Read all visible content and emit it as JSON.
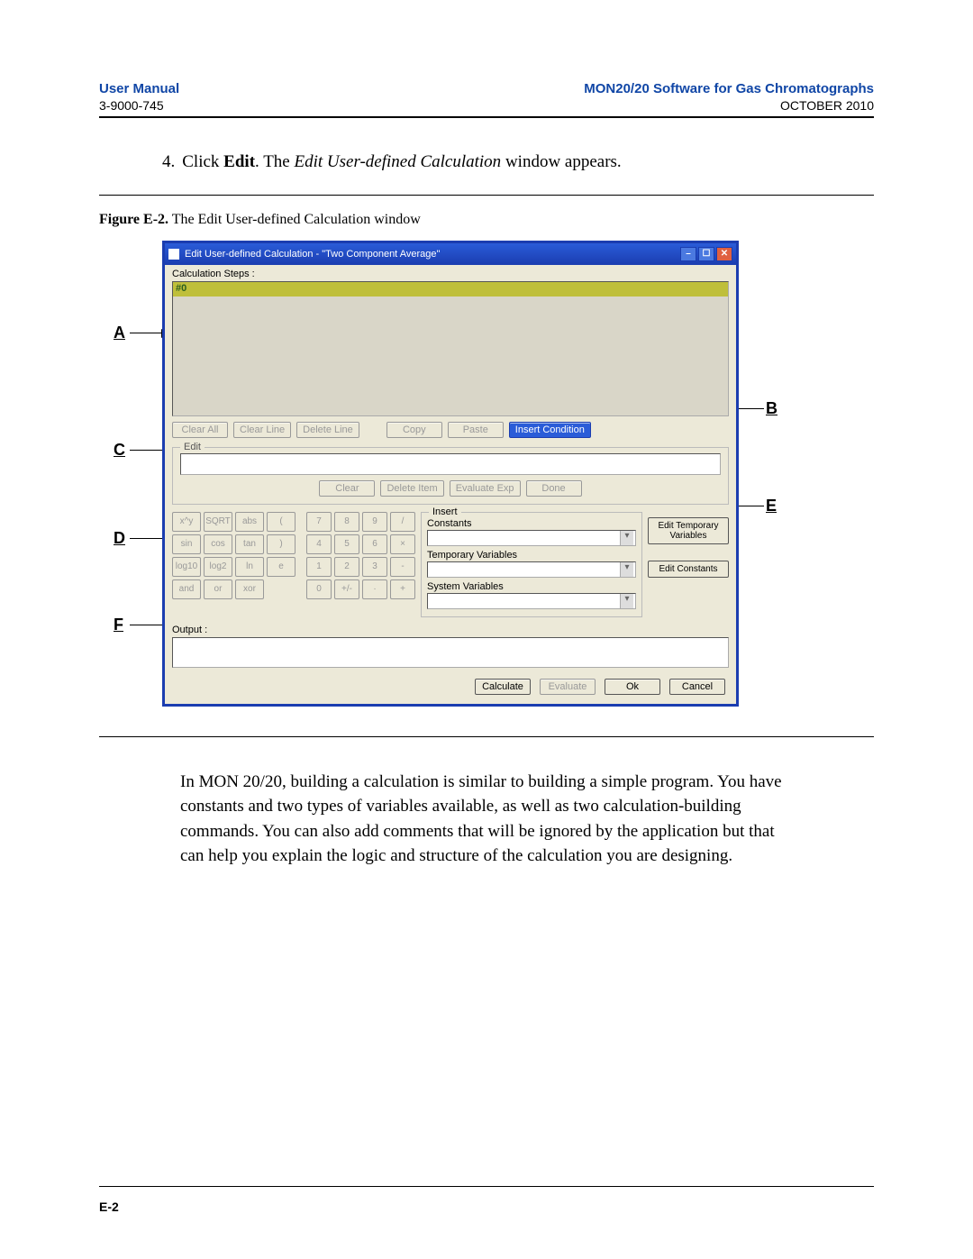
{
  "header": {
    "left_title": "User Manual",
    "left_sub": "3-9000-745",
    "right_title": "MON20/20 Software for Gas Chromatographs",
    "right_sub": "OCTOBER 2010"
  },
  "step": {
    "num": "4.",
    "pre": "Click ",
    "bold": "Edit",
    "mid": ".  The ",
    "ital": "Edit User-defined Calculation",
    "post": " window appears."
  },
  "figure": {
    "num": "Figure E-2.",
    "caption": "The Edit User-defined Calculation window"
  },
  "callouts": {
    "A": "A",
    "B": "B",
    "C": "C",
    "D": "D",
    "E": "E",
    "F": "F"
  },
  "window": {
    "title": "Edit User-defined Calculation - \"Two Component Average\"",
    "calc_steps_label": "Calculation Steps :",
    "step0": "#0",
    "row1": {
      "clear_all": "Clear All",
      "clear_line": "Clear Line",
      "delete_line": "Delete Line",
      "copy": "Copy",
      "paste": "Paste",
      "insert_condition": "Insert Condition"
    },
    "edit_legend": "Edit",
    "row2": {
      "clear": "Clear",
      "delete_item": "Delete Item",
      "evaluate_exp": "Evaluate Exp",
      "done": "Done"
    },
    "keypad": [
      [
        "x^y",
        "SQRT",
        "abs",
        "(",
        "7",
        "8",
        "9",
        "/"
      ],
      [
        "sin",
        "cos",
        "tan",
        ")",
        "4",
        "5",
        "6",
        "×"
      ],
      [
        "log10",
        "log2",
        "ln",
        "e",
        "1",
        "2",
        "3",
        "-"
      ],
      [
        "and",
        "or",
        "xor",
        "",
        "0",
        "+/-",
        "·",
        "+"
      ]
    ],
    "insert": {
      "legend": "Insert",
      "constants": "Constants",
      "temp_vars": "Temporary Variables",
      "sys_vars": "System Variables"
    },
    "side": {
      "edit_temp": "Edit Temporary Variables",
      "edit_const": "Edit Constants"
    },
    "output_label": "Output :",
    "bottom": {
      "calculate": "Calculate",
      "evaluate": "Evaluate",
      "ok": "Ok",
      "cancel": "Cancel"
    }
  },
  "body_para": "In MON 20/20, building a calculation is similar to building a simple program.  You have constants and two types of variables available, as well as two calculation-building commands.  You can also add comments that will be ignored by the application but that can help you explain the logic and structure of the calculation you are designing.",
  "footer": "E-2"
}
